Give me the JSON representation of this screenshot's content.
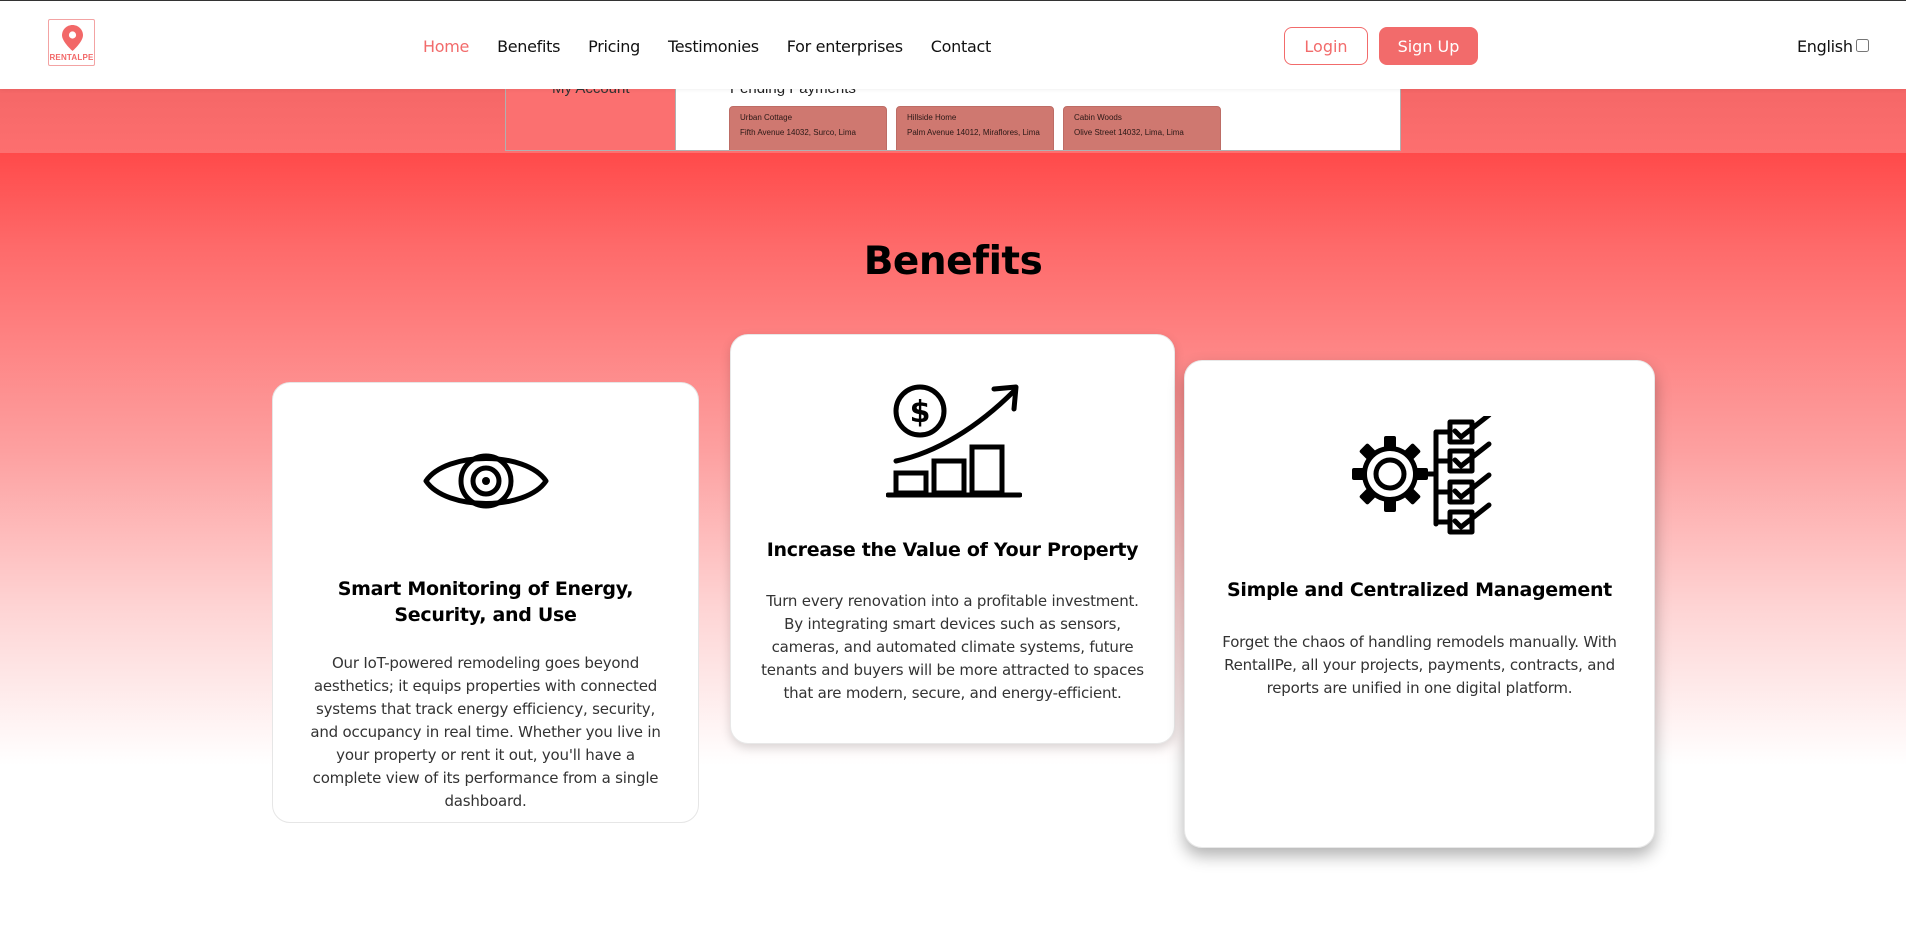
{
  "brand": {
    "name": "RENTALPE",
    "accent_color": "#f26b6b"
  },
  "nav": {
    "items": [
      {
        "label": "Home",
        "active": true
      },
      {
        "label": "Benefits",
        "active": false
      },
      {
        "label": "Pricing",
        "active": false
      },
      {
        "label": "Testimonies",
        "active": false
      },
      {
        "label": "For enterprises",
        "active": false
      },
      {
        "label": "Contact",
        "active": false
      }
    ],
    "login_label": "Login",
    "signup_label": "Sign Up",
    "language_label": "English"
  },
  "preview": {
    "sidebar_item": "My Account",
    "section_title": "Pending Payments",
    "cards": [
      {
        "name": "Urban Cottage",
        "address": "Fifth Avenue 14032, Surco, Lima"
      },
      {
        "name": "Hillside Home",
        "address": "Palm Avenue 14012, Miraflores, Lima"
      },
      {
        "name": "Cabin Woods",
        "address": "Olive Street 14032, Lima, Lima"
      }
    ]
  },
  "benefits": {
    "heading": "Benefits",
    "cards": [
      {
        "icon": "eye-icon",
        "title": "Smart Monitoring of Energy, Security, and Use",
        "text": "Our IoT-powered remodeling goes beyond aesthetics; it equips properties with connected systems that track energy efficiency, security, and occupancy in real time. Whether you live in your property or rent it out, you'll have a complete view of its performance from a single dashboard."
      },
      {
        "icon": "growth-chart-icon",
        "title": "Increase the Value of Your Property",
        "text": "Turn every renovation into a profitable investment. By integrating smart devices such as sensors, cameras, and automated climate systems, future tenants and buyers will be more attracted to spaces that are modern, secure, and energy-efficient."
      },
      {
        "icon": "gear-checklist-icon",
        "title": "Simple and Centralized Management",
        "text": "Forget the chaos of handling remodels manually. With RentalIPe, all your projects, payments, contracts, and reports are unified in one digital platform."
      }
    ]
  }
}
